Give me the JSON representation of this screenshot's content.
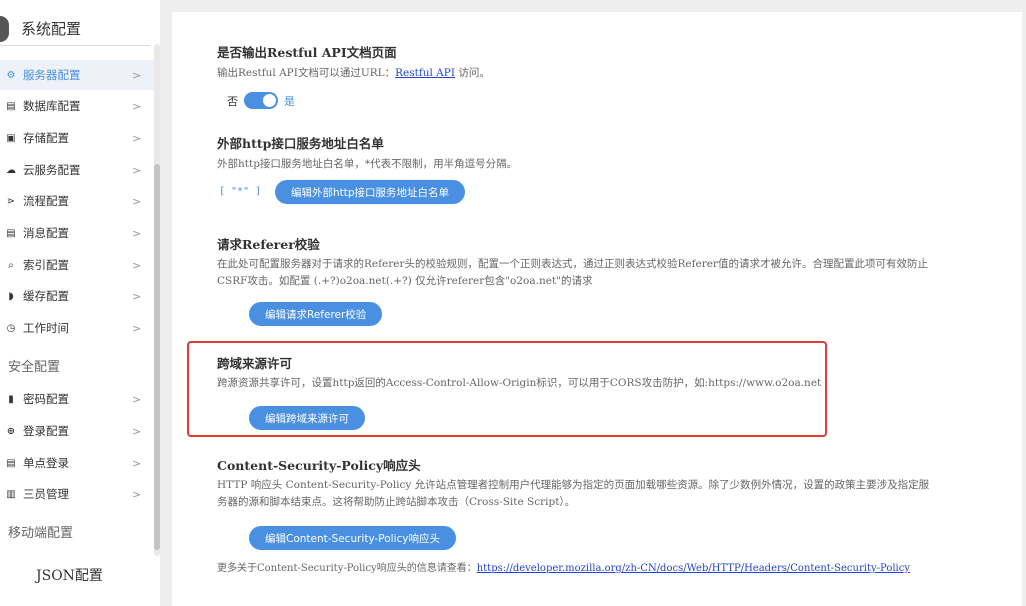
{
  "sidebar": {
    "title": "系统配置",
    "items": [
      {
        "label": "服务器配置",
        "icon": "server-icon",
        "glyph": "⚙"
      },
      {
        "label": "数据库配置",
        "icon": "database-icon",
        "glyph": "▤"
      },
      {
        "label": "存储配置",
        "icon": "storage-icon",
        "glyph": "▣"
      },
      {
        "label": "云服务配置",
        "icon": "cloud-icon",
        "glyph": "☁"
      },
      {
        "label": "流程配置",
        "icon": "flow-icon",
        "glyph": "⋗"
      },
      {
        "label": "消息配置",
        "icon": "message-icon",
        "glyph": "▤"
      },
      {
        "label": "索引配置",
        "icon": "index-icon",
        "glyph": "⌕"
      },
      {
        "label": "缓存配置",
        "icon": "cache-icon",
        "glyph": "◗"
      },
      {
        "label": "工作时间",
        "icon": "clock-icon",
        "glyph": "◷"
      }
    ],
    "security_group": "安全配置",
    "security_items": [
      {
        "label": "密码配置",
        "icon": "lock-icon",
        "glyph": "▮"
      },
      {
        "label": "登录配置",
        "icon": "login-icon",
        "glyph": "⊕"
      },
      {
        "label": "单点登录",
        "icon": "sso-icon",
        "glyph": "▤"
      },
      {
        "label": "三员管理",
        "icon": "admin-icon",
        "glyph": "▥"
      }
    ],
    "mobile_group": "移动端配置",
    "json_label": "JSON配置",
    "chevron": ">"
  },
  "main": {
    "restful": {
      "title": "是否输出Restful API文档页面",
      "desc_prefix": "输出Restful API文档可以通过URL：",
      "link": "Restful API",
      "desc_suffix": " 访问。",
      "off_label": "否",
      "on_label": "是"
    },
    "whitelist": {
      "title": "外部http接口服务地址白名单",
      "desc": "外部http接口服务地址白名单，*代表不限制，用半角逗号分隔。",
      "value": "[ \"*\" ]",
      "button": "编辑外部http接口服务地址白名单"
    },
    "referer": {
      "title": "请求Referer校验",
      "desc": "在此处可配置服务器对于请求的Referer头的校验规则，配置一个正则表达式，通过正则表达式校验Referer值的请求才被允许。合理配置此项可有效防止CSRF攻击。如配置 (.+?)o2oa.net(.+?) 仅允许referer包含\"o2oa.net\"的请求",
      "button": "编辑请求Referer校验"
    },
    "cors": {
      "title": "跨域来源许可",
      "desc": "跨源资源共享许可，设置http返回的Access-Control-Allow-Origin标识，可以用于CORS攻击防护，如:https://www.o2oa.net",
      "button": "编辑跨域来源许可"
    },
    "csp": {
      "title": "Content-Security-Policy响应头",
      "desc": "HTTP 响应头 Content-Security-Policy 允许站点管理者控制用户代理能够为指定的页面加载哪些资源。除了少数例外情况，设置的政策主要涉及指定服务器的源和脚本结束点。这将帮助防止跨站脚本攻击（Cross-Site Script）。",
      "button": "编辑Content-Security-Policy响应头",
      "more_prefix": "更多关于Content-Security-Policy响应头的信息请查看：",
      "more_link": "https://developer.mozilla.org/zh-CN/docs/Web/HTTP/Headers/Content-Security-Policy"
    }
  },
  "colors": {
    "accent": "#4a90e2",
    "highlight": "#e53935"
  }
}
